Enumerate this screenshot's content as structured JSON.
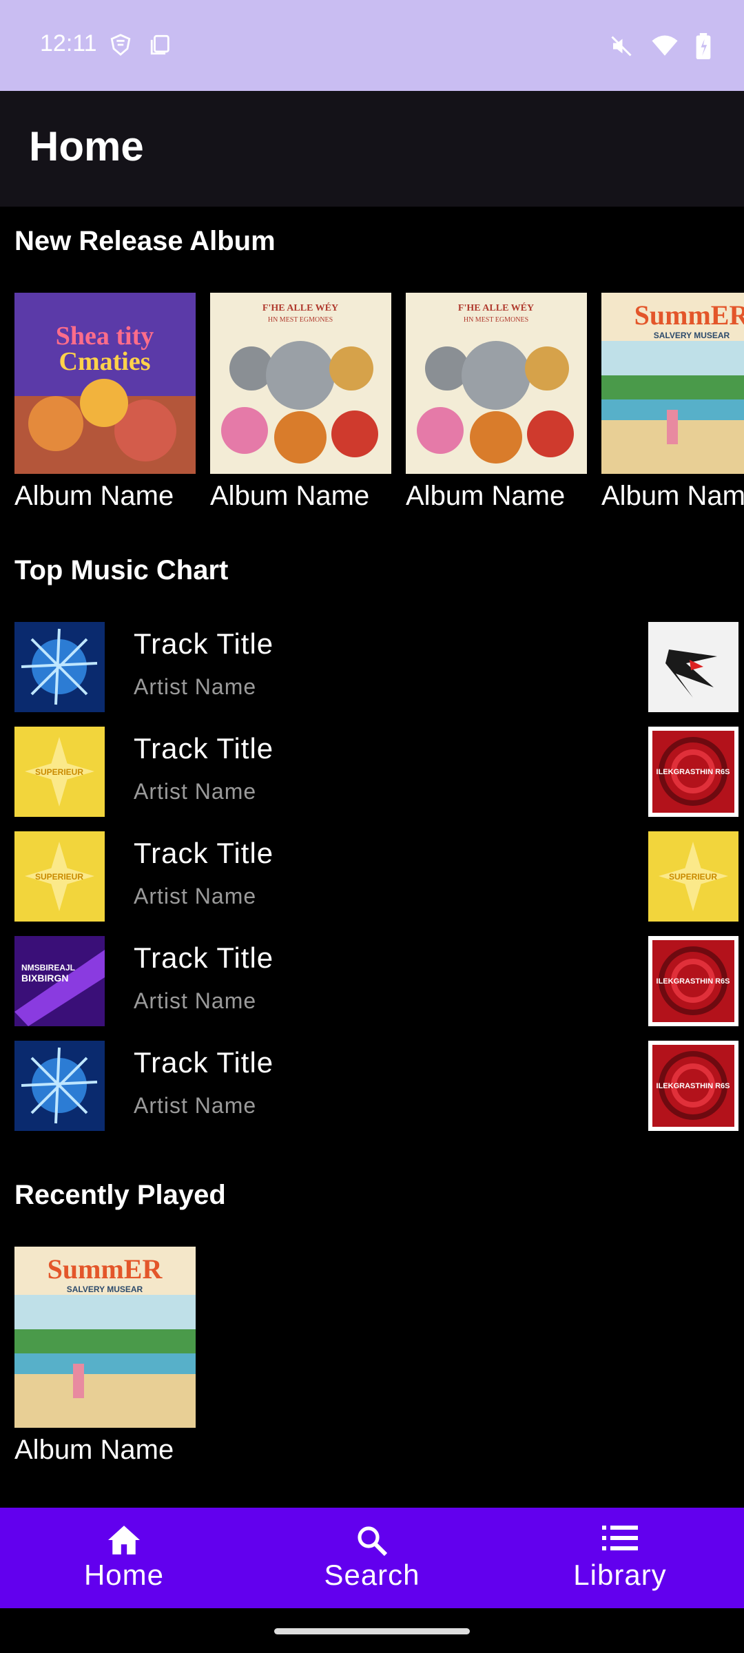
{
  "status_bar": {
    "time": "12:11"
  },
  "app_bar": {
    "title": "Home"
  },
  "sections": {
    "new_release": "New Release Album",
    "top_chart": "Top Music Chart",
    "recently_played": "Recently Played"
  },
  "new_release_albums": [
    {
      "name": "Album Name"
    },
    {
      "name": "Album Name"
    },
    {
      "name": "Album Name"
    },
    {
      "name": "Album Name"
    }
  ],
  "top_tracks": [
    {
      "title": "Track Title",
      "artist": "Artist Name"
    },
    {
      "title": "Track Title",
      "artist": "Artist Name"
    },
    {
      "title": "Track Title",
      "artist": "Artist Name"
    },
    {
      "title": "Track Title",
      "artist": "Artist Name"
    },
    {
      "title": "Track Title",
      "artist": "Artist Name"
    }
  ],
  "recently_played": [
    {
      "name": "Album Name"
    }
  ],
  "bottom_nav": [
    {
      "label": "Home",
      "icon": "home-icon"
    },
    {
      "label": "Search",
      "icon": "search-icon"
    },
    {
      "label": "Library",
      "icon": "library-icon"
    }
  ],
  "colors": {
    "status_bar": "#c9bdf2",
    "app_bar": "#141218",
    "background": "#000000",
    "bottom_nav": "#6200ee",
    "secondary_text": "#9a9a9a"
  }
}
